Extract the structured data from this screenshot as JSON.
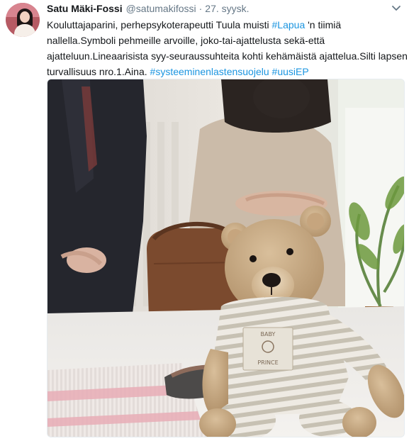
{
  "tweet": {
    "author_name": "Satu Mäki-Fossi",
    "author_handle": "@satumakifossi",
    "separator": "·",
    "timestamp": "27. syysk.",
    "text_lines": [
      [
        "Kouluttajaparini, perhepsykoterapeutti Tuula muisti ",
        "#Lapua",
        " 'n tiimiä"
      ],
      [
        "nallella.Symboli pehmeille arvoille, joko-tai-ajattelusta sekä-että"
      ],
      [
        "ajatteluun.Lineaarisista syy-seuraussuhteita kohti kehämäistä ajattelua.Silti lapsen"
      ],
      [
        "turvallisuus nro.1.Aina. ",
        "#systeeminenlastensuojelu",
        " ",
        "#uusiEP"
      ]
    ],
    "bear_shirt_print": [
      "BABY",
      "PRINCE"
    ],
    "icons": {
      "avatar": "profile-photo",
      "menu": "chevron-down-icon"
    },
    "colors": {
      "link": "#1b95e0",
      "secondary_text": "#657786"
    }
  }
}
